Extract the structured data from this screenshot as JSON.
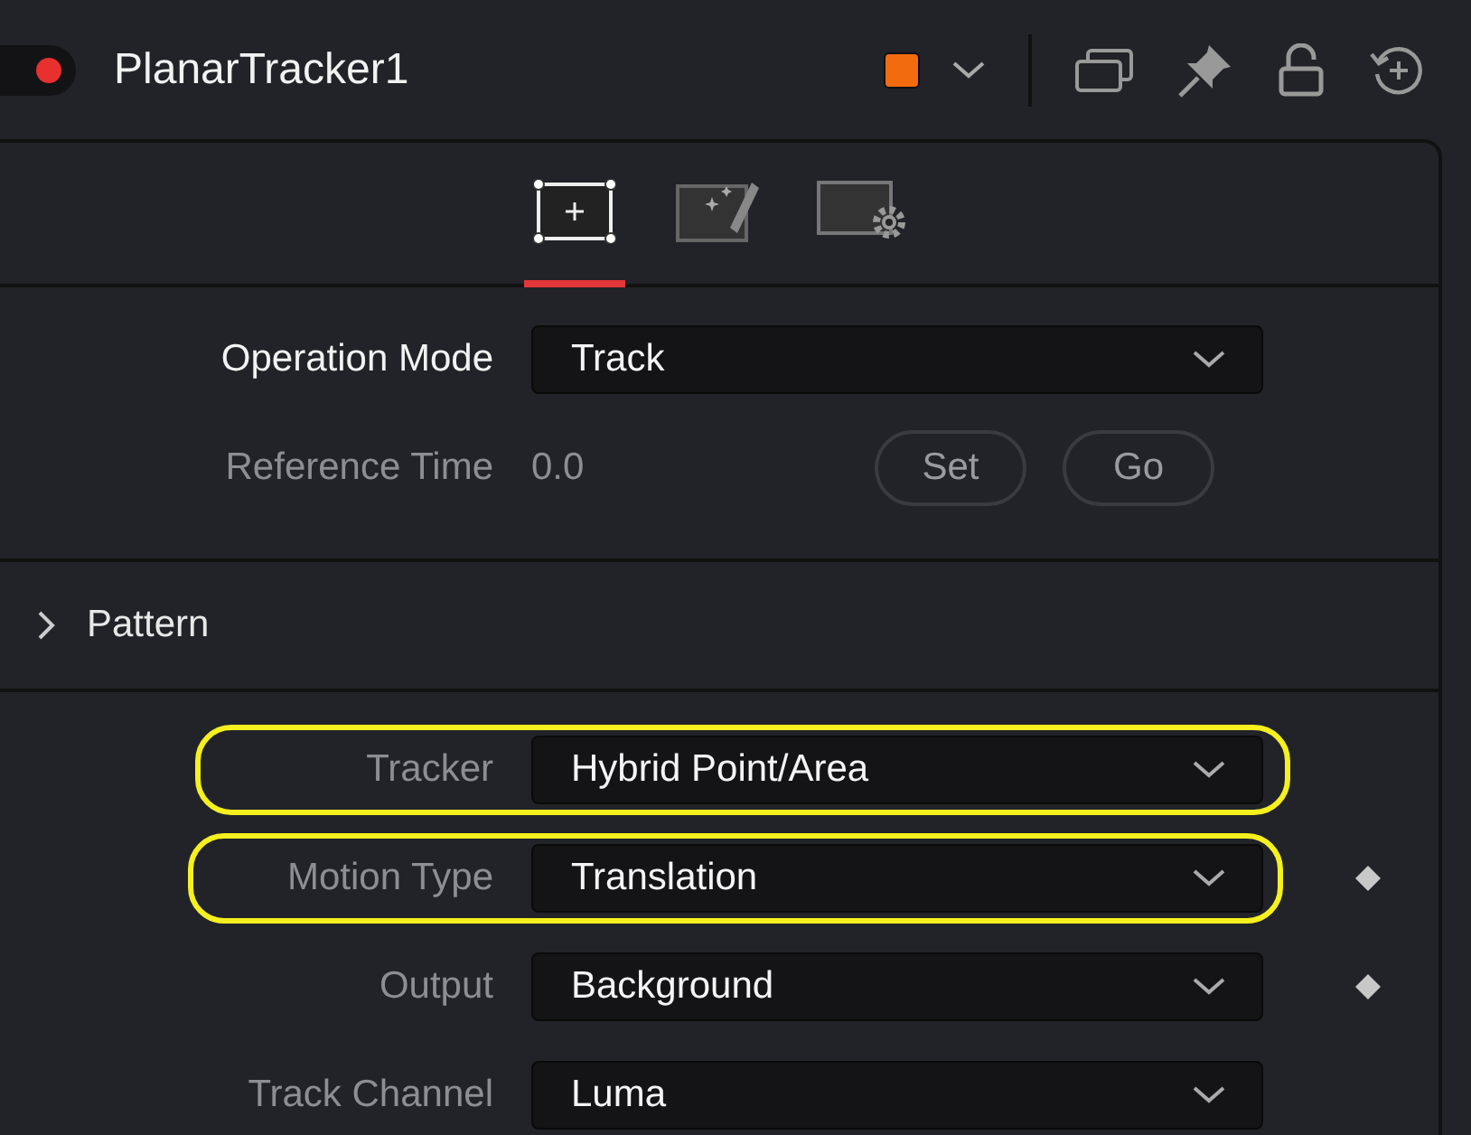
{
  "node": {
    "enabled": true,
    "title": "PlanarTracker1",
    "color": "#f26b0f"
  },
  "tabs": [
    {
      "kind": "track",
      "selected": true
    },
    {
      "kind": "paint",
      "selected": false
    },
    {
      "kind": "settings",
      "selected": false
    }
  ],
  "controls": [
    {
      "kind": "dropdown",
      "label": "Operation Mode",
      "value": "Track",
      "active": true
    },
    {
      "kind": "time",
      "label": "Reference Time",
      "value": "0.0",
      "active": false,
      "buttons": [
        "Set",
        "Go"
      ]
    }
  ],
  "section": {
    "title": "Pattern",
    "expanded": false
  },
  "settings": [
    {
      "label": "Tracker",
      "value": "Hybrid Point/Area",
      "highlighted": true,
      "keyframe": false
    },
    {
      "label": "Motion Type",
      "value": "Translation",
      "highlighted": true,
      "keyframe": true
    },
    {
      "label": "Output",
      "value": "Background",
      "highlighted": false,
      "keyframe": true
    },
    {
      "label": "Track Channel",
      "value": "Luma",
      "highlighted": false,
      "keyframe": false
    }
  ]
}
